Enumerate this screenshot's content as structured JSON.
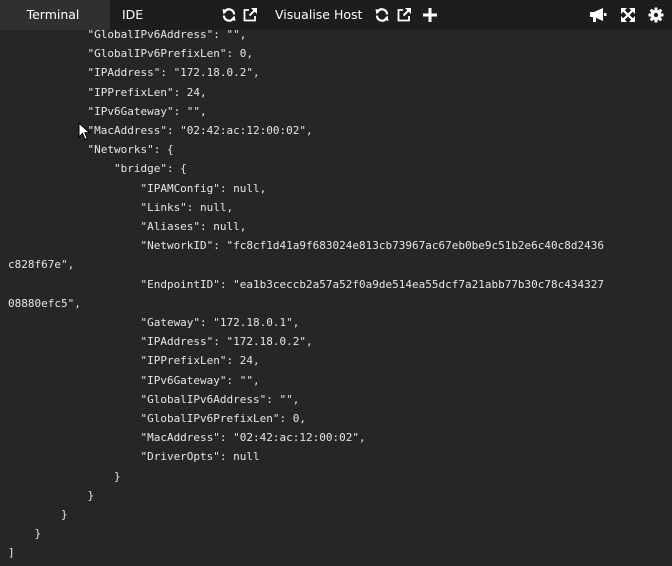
{
  "tabs": {
    "terminal": "Terminal",
    "ide": "IDE"
  },
  "host": {
    "label": "Visualise Host"
  },
  "icons": {
    "ide_refresh": "refresh-icon",
    "ide_open_external": "external-link-icon",
    "host_refresh": "refresh-icon",
    "host_open_external": "external-link-icon",
    "add": "plus-icon",
    "announce": "megaphone-icon",
    "fullscreen": "expand-icon",
    "settings": "gear-icon"
  },
  "colors": {
    "toolbar_bg": "#1d1d1d",
    "active_tab_bg": "#303030",
    "terminal_bg": "#262626",
    "terminal_text": "#e6e6e6"
  },
  "terminal": {
    "lines": [
      "            \"GlobalIPv6Address\": \"\",",
      "            \"GlobalIPv6PrefixLen\": 0,",
      "            \"IPAddress\": \"172.18.0.2\",",
      "            \"IPPrefixLen\": 24,",
      "            \"IPv6Gateway\": \"\",",
      "            \"MacAddress\": \"02:42:ac:12:00:02\",",
      "            \"Networks\": {",
      "                \"bridge\": {",
      "                    \"IPAMConfig\": null,",
      "                    \"Links\": null,",
      "                    \"Aliases\": null,",
      "                    \"NetworkID\": \"fc8cf1d41a9f683024e813cb73967ac67eb0be9c51b2e6c40c8d2436",
      "c828f67e\",",
      "                    \"EndpointID\": \"ea1b3ceccb2a57a52f0a9de514ea55dcf7a21abb77b30c78c434327",
      "08880efc5\",",
      "                    \"Gateway\": \"172.18.0.1\",",
      "                    \"IPAddress\": \"172.18.0.2\",",
      "                    \"IPPrefixLen\": 24,",
      "                    \"IPv6Gateway\": \"\",",
      "                    \"GlobalIPv6Address\": \"\",",
      "                    \"GlobalIPv6PrefixLen\": 0,",
      "                    \"MacAddress\": \"02:42:ac:12:00:02\",",
      "                    \"DriverOpts\": null",
      "                }",
      "            }",
      "        }",
      "    }",
      "]"
    ]
  }
}
